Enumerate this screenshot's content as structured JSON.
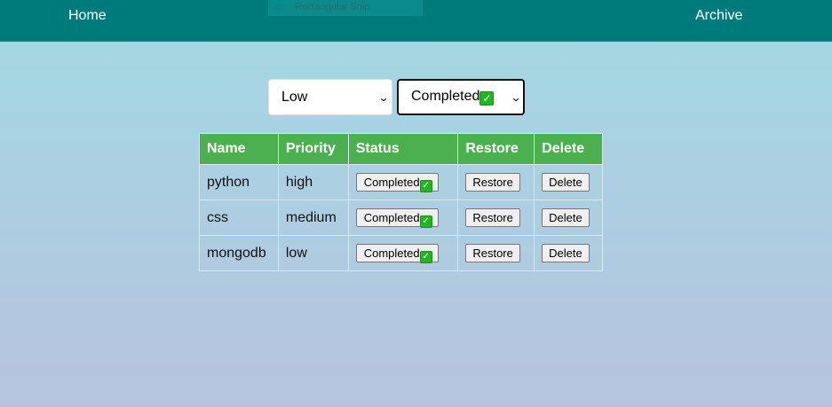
{
  "nav": {
    "home": "Home",
    "archive": "Archive"
  },
  "snip": {
    "label": "Rectangular Snip"
  },
  "filters": {
    "priority": {
      "selected": "Low"
    },
    "status": {
      "selected": "Completed"
    }
  },
  "table": {
    "headers": [
      "Name",
      "Priority",
      "Status",
      "Restore",
      "Delete"
    ],
    "rows": [
      {
        "name": "python",
        "priority": "high",
        "status": "Completed",
        "restore": "Restore",
        "delete": "Delete"
      },
      {
        "name": "css",
        "priority": "medium",
        "status": "Completed",
        "restore": "Restore",
        "delete": "Delete"
      },
      {
        "name": "mongodb",
        "priority": "low",
        "status": "Completed",
        "restore": "Restore",
        "delete": "Delete"
      }
    ]
  },
  "icons": {
    "completed": "check-mark-icon",
    "dropdown": "chevron-down-icon"
  },
  "colors": {
    "navbar": "#007b7c",
    "table_header": "#4caf50",
    "check": "#23b523"
  }
}
